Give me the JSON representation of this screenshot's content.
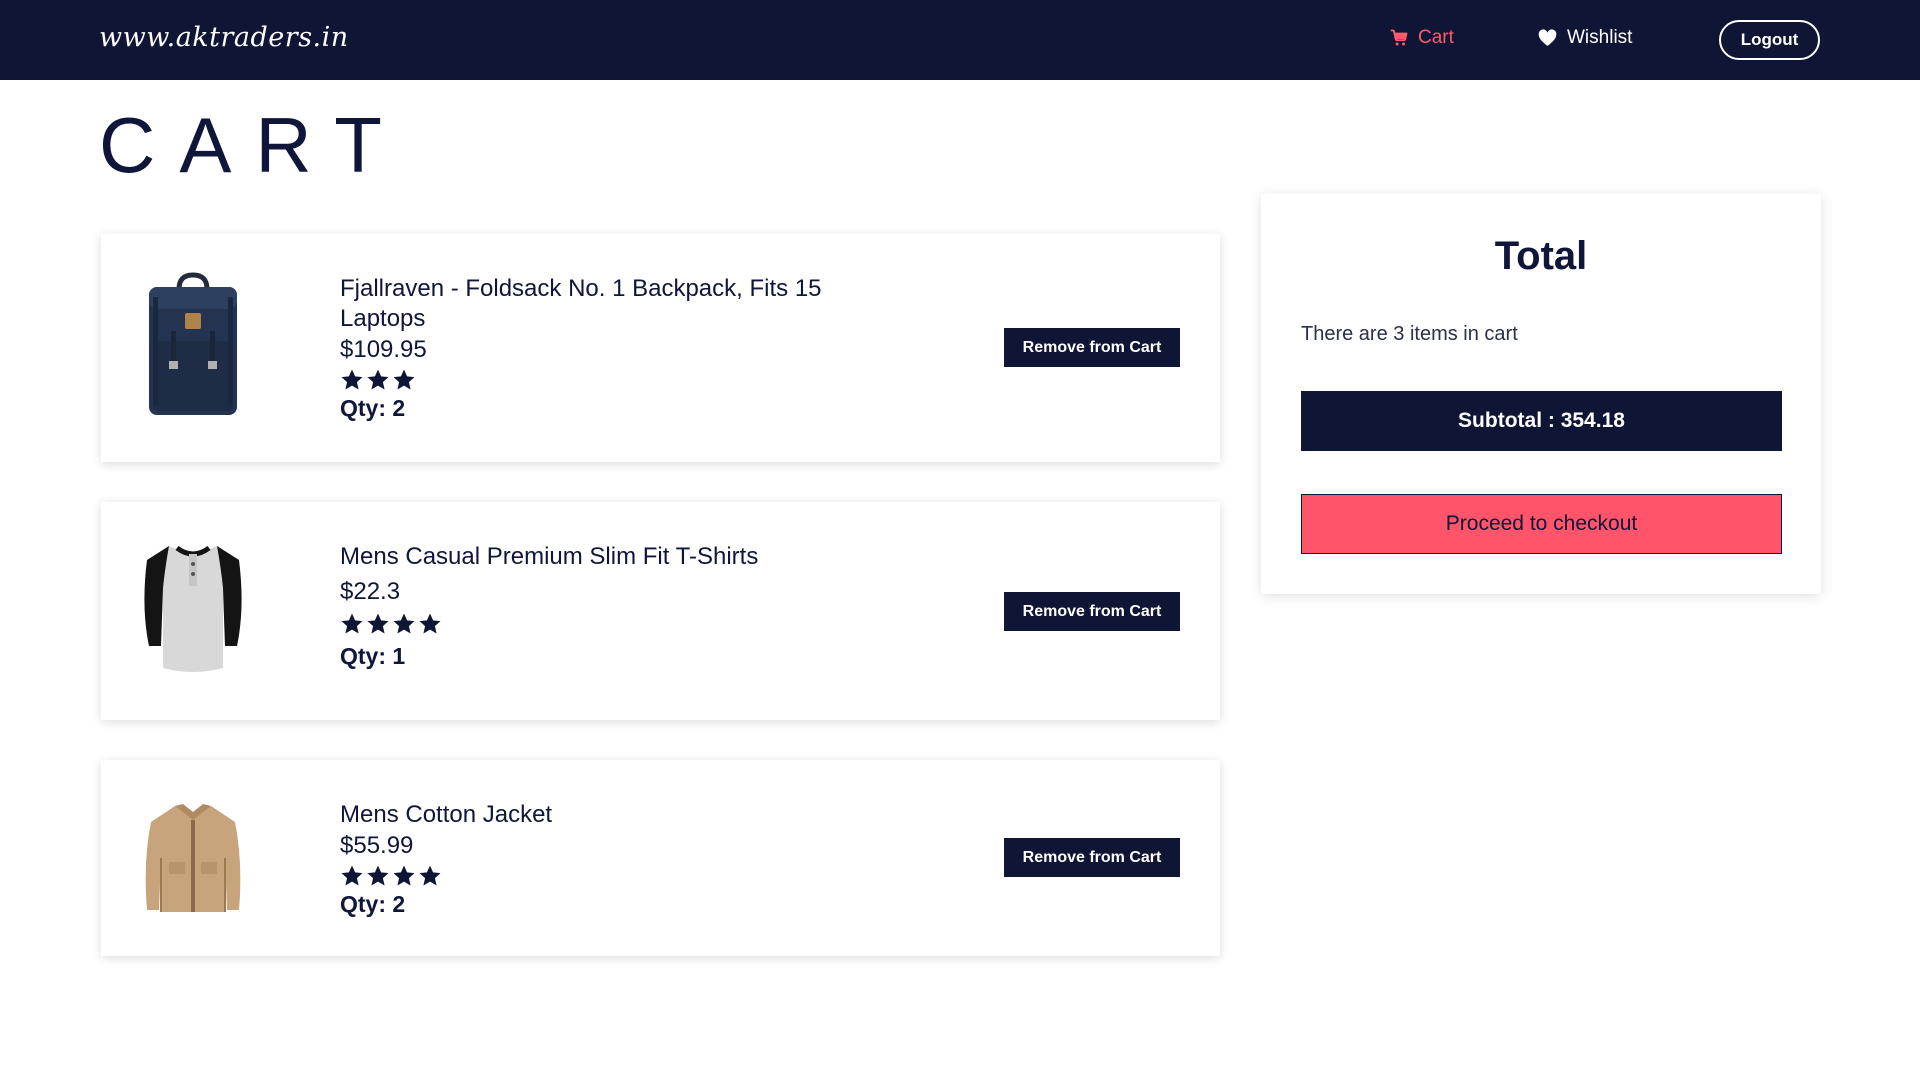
{
  "colors": {
    "nav_bg": "#0f1535",
    "accent": "#ff5469",
    "text": "#10163a",
    "star": "#0f1535"
  },
  "nav": {
    "brand": "www.aktraders.in",
    "cart_label": "Cart",
    "cart_icon": "cart-icon",
    "wishlist_label": "Wishlist",
    "wishlist_icon": "heart-icon",
    "logout_label": "Logout"
  },
  "page": {
    "title": "CART"
  },
  "cart": {
    "items": [
      {
        "name": "Fjallraven - Foldsack No. 1 Backpack, Fits 15 Laptops",
        "price": "$109.95",
        "rating": 3,
        "qty": "Qty: 2",
        "remove_label": "Remove from Cart",
        "image": "backpack-image"
      },
      {
        "name": "Mens Casual Premium Slim Fit T-Shirts",
        "price": "$22.3",
        "rating": 4,
        "qty": "Qty: 1",
        "remove_label": "Remove from Cart",
        "image": "tshirt-image"
      },
      {
        "name": "Mens Cotton Jacket",
        "price": "$55.99",
        "rating": 4,
        "qty": "Qty: 2",
        "remove_label": "Remove from Cart",
        "image": "jacket-image"
      }
    ]
  },
  "summary": {
    "title": "Total",
    "count_text": "There are 3 items in cart",
    "subtotal_text": "Subtotal : 354.18",
    "checkout_label": "Proceed to checkout"
  }
}
